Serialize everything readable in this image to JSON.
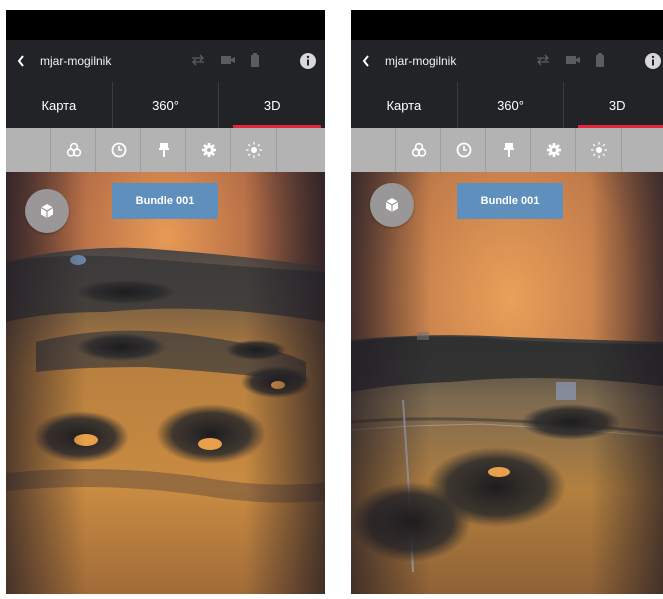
{
  "screens": [
    {
      "app_title": "mjar-mogilnik",
      "tabs": [
        {
          "label": "Карта",
          "active": false
        },
        {
          "label": "360°",
          "active": false
        },
        {
          "label": "3D",
          "active": true
        }
      ],
      "toolbar_icons": [
        "layers-icon",
        "clock-icon",
        "marker-icon",
        "gear-icon",
        "brightness-icon"
      ],
      "bundle_label": "Bundle 001"
    },
    {
      "app_title": "mjar-mogilnik",
      "tabs": [
        {
          "label": "Карта",
          "active": false
        },
        {
          "label": "360°",
          "active": false
        },
        {
          "label": "3D",
          "active": true
        }
      ],
      "toolbar_icons": [
        "layers-icon",
        "clock-icon",
        "marker-icon",
        "gear-icon",
        "brightness-icon"
      ],
      "bundle_label": "Bundle 001"
    }
  ],
  "colors": {
    "appbar": "#222326",
    "toolbar": "#b3b3b3",
    "tab_indicator": "#e3263a",
    "bundle_button": "#5f8fbc",
    "cube_button": "#9a9798"
  }
}
